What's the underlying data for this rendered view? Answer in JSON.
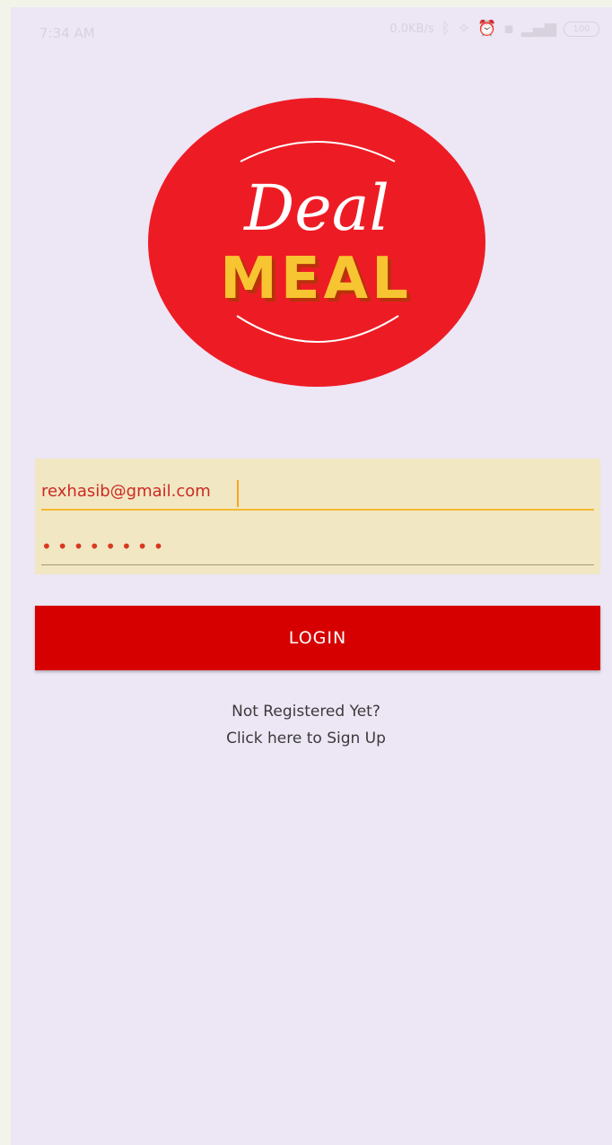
{
  "status_bar": {
    "time": "7:34 AM",
    "network_speed": "0.0KB/s",
    "icons": [
      "bluetooth-icon",
      "sync-off-icon",
      "alarm-icon",
      "hd-icon",
      "signal-icon",
      "battery-icon"
    ],
    "battery": "100"
  },
  "logo": {
    "line1": "Deal",
    "line2": "MEAL",
    "colors": {
      "circle": "#ed1c24",
      "script": "#ffffff",
      "block": "#f7c531"
    }
  },
  "login_form": {
    "email_value": "rexhasib@gmail.com",
    "password_value": "••••••••",
    "login_label": "LOGIN"
  },
  "signup": {
    "prompt": "Not Registered Yet?",
    "link": "Click here to Sign Up"
  }
}
